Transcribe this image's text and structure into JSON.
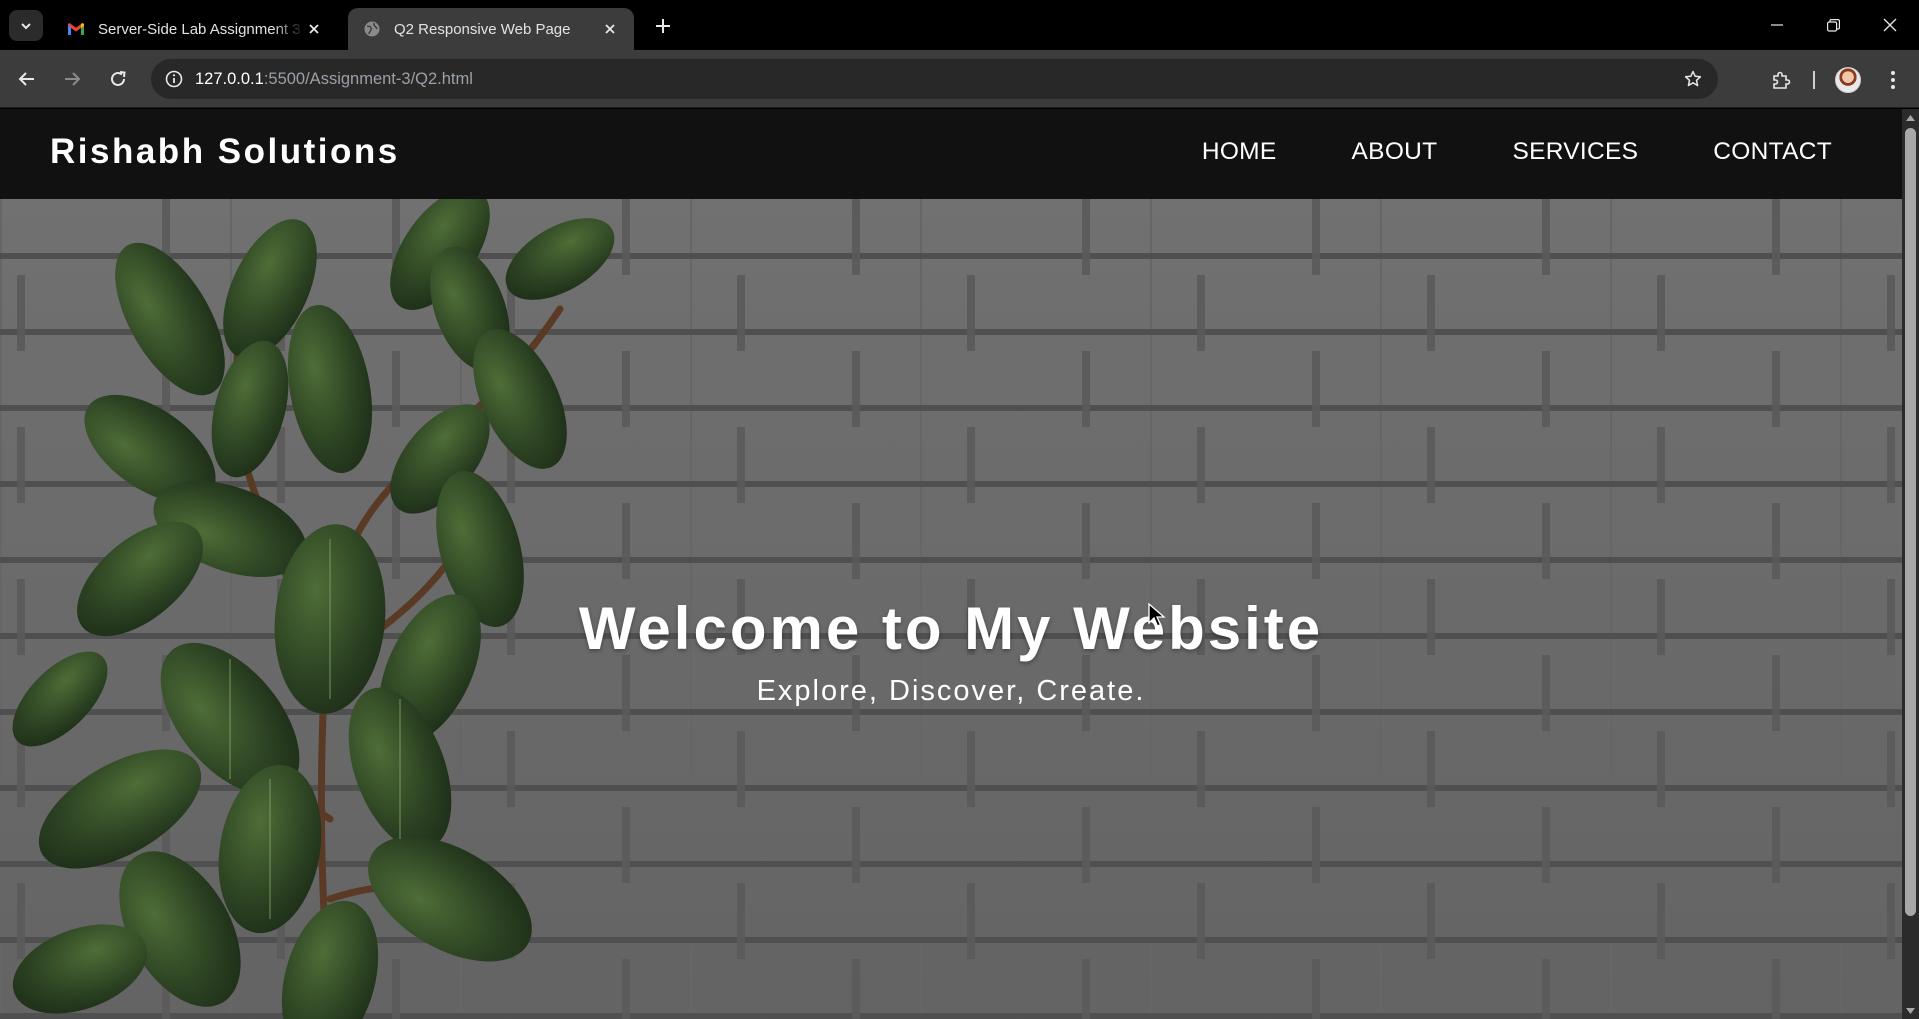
{
  "browser": {
    "tabs": [
      {
        "title": "Server-Side Lab Assignment 3 -",
        "favicon": "gmail-icon",
        "active": false
      },
      {
        "title": "Q2 Responsive Web Page",
        "favicon": "globe-icon",
        "active": true
      }
    ],
    "url": {
      "host": "127.0.0.1",
      "rest": ":5500/Assignment-3/Q2.html"
    }
  },
  "site": {
    "logo": "Rishabh Solutions",
    "nav": [
      "HOME",
      "ABOUT",
      "SERVICES",
      "CONTACT"
    ],
    "hero": {
      "title": "Welcome to My Website",
      "subtitle": "Explore, Discover, Create."
    }
  },
  "colors": {
    "header_bg": "#111111",
    "tab_active_bg": "#3c3c3c",
    "omnibox_bg": "#282828"
  }
}
